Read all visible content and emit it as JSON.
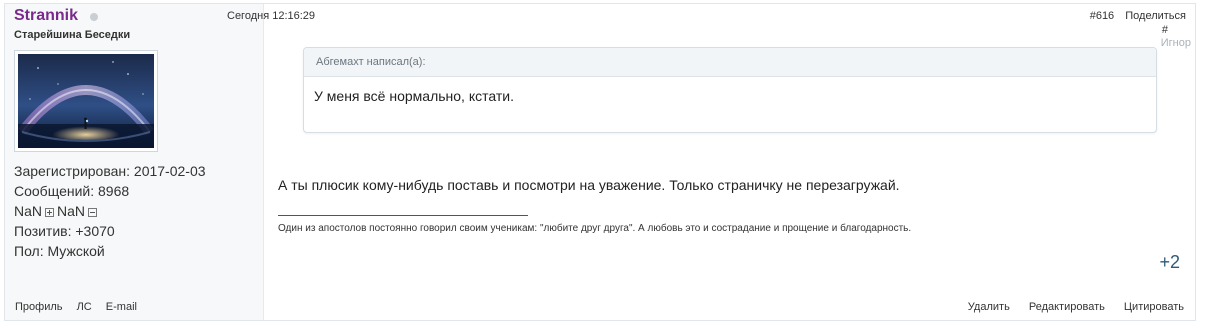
{
  "author": {
    "username": "Strannik",
    "title": "Старейшина Беседки",
    "stats": {
      "registered": "Зарегистрирован: 2017-02-03",
      "messages": "Сообщений: 8968",
      "nan_a": "NaN",
      "nan_b": "NaN",
      "positive": "Позитив: +3070",
      "gender": "Пол: Мужской"
    },
    "links": [
      "Профиль",
      "ЛС",
      "E-mail"
    ]
  },
  "post": {
    "date": "Сегодня 12:16:29",
    "number": "#616",
    "share": "Поделиться",
    "hash": "#",
    "ignore": "Игнор",
    "quote": {
      "author": "Абгемахт написал(а):",
      "text": "У меня всё нормально, кстати."
    },
    "text": "А ты плюсик кому-нибудь поставь и посмотри на уважение. Только страничку не перезагружай.",
    "signature": "Один из апостолов постоянно говорил своим ученикам: \"любите друг друга\". А любовь это и сострадание и прощение и благодарность.",
    "reputation": "+2",
    "actions": [
      "Удалить",
      "Редактировать",
      "Цитировать"
    ]
  },
  "colors": {
    "username": "#7a2a8a",
    "sidebar_bg": "#f6f8f9",
    "quote_head_bg": "#f2f5f7",
    "reputation": "#2d5a7a"
  },
  "icons": {
    "online_status": "status-dot-icon",
    "expand": "plus-box-icon",
    "collapse": "minus-box-icon"
  }
}
